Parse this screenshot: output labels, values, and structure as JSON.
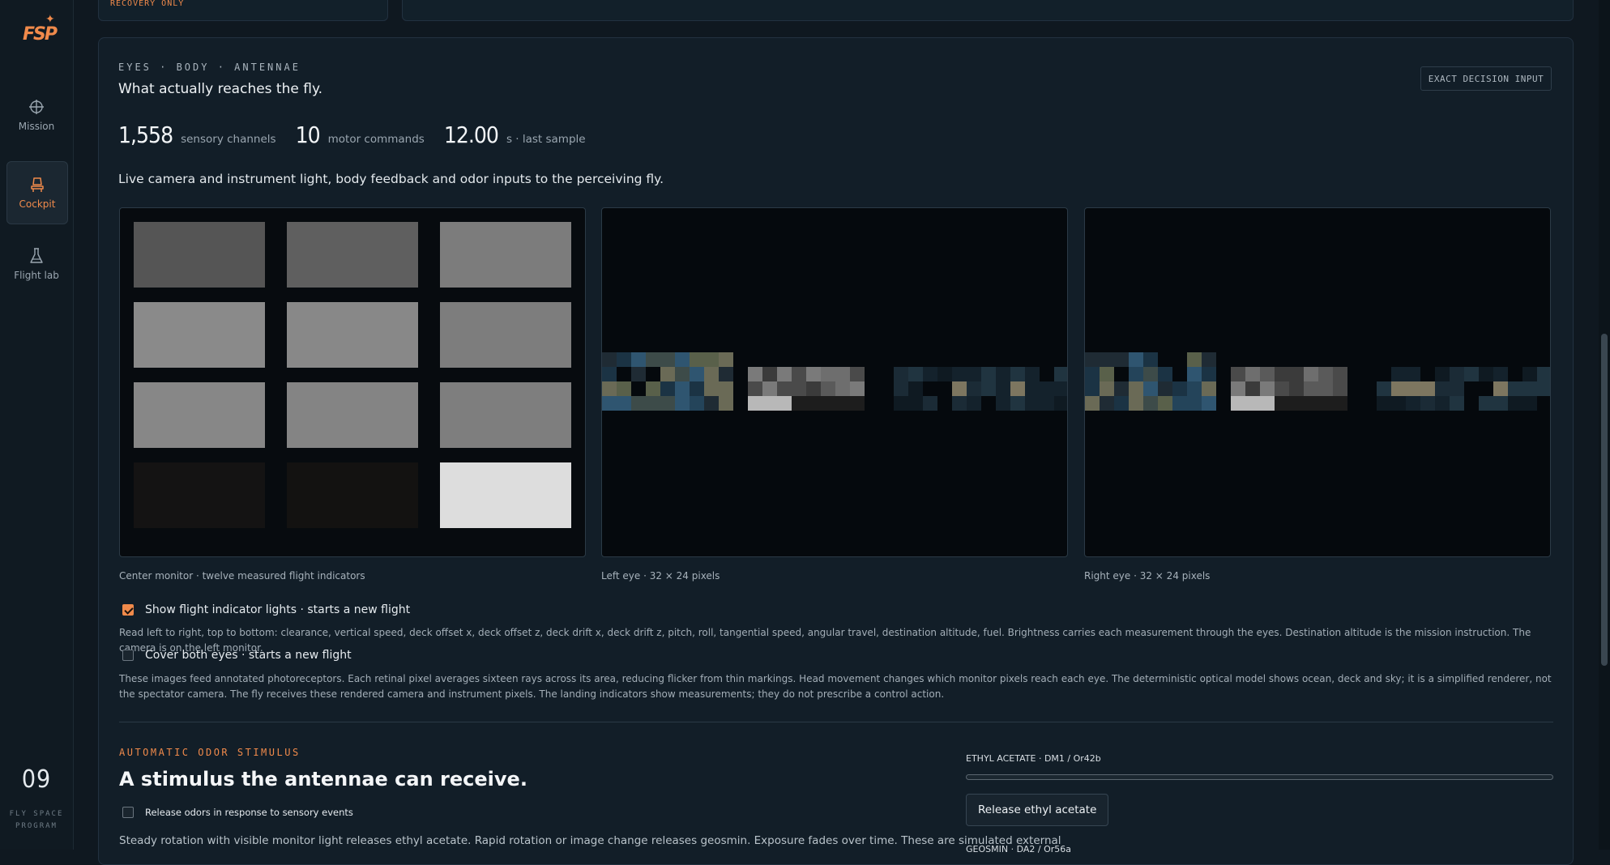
{
  "sidebar": {
    "logo_text": "FSP",
    "items": [
      {
        "label": "Mission",
        "icon": "crosshair-icon",
        "active": false
      },
      {
        "label": "Cockpit",
        "icon": "seat-icon",
        "active": true
      },
      {
        "label": "Flight lab",
        "icon": "flask-icon",
        "active": false
      }
    ],
    "number": "09",
    "caption_line1": "FLY SPACE",
    "caption_line2": "PROGRAM"
  },
  "top": {
    "left_stub": "RECOVERY ONLY"
  },
  "perception": {
    "eyebrow": "EYES · BODY · ANTENNAE",
    "headline": "What actually reaches the fly.",
    "badge": "EXACT DECISION INPUT",
    "stats": [
      {
        "value": "1,558",
        "label": "sensory channels"
      },
      {
        "value": "10",
        "label": "motor commands"
      },
      {
        "value": "12.00",
        "label": "s · last sample"
      }
    ],
    "intro": "Live camera and instrument light, body feedback and odor inputs to the perceiving fly.",
    "monitor_tiles": [
      "#555555",
      "#5f5f5f",
      "#7c7c7c",
      "#8a8a8a",
      "#888888",
      "#7d7d7d",
      "#878787",
      "#848484",
      "#7e7e7e",
      "#141313",
      "#131211",
      "#dddddd"
    ],
    "captions": {
      "monitor": "Center monitor · twelve measured flight indicators",
      "left_eye": "Left eye · 32 × 24 pixels",
      "right_eye": "Right eye · 32 × 24 pixels"
    },
    "option1": {
      "label": "Show flight indicator lights · starts a new flight",
      "checked": true
    },
    "option1_help": "Read left to right, top to bottom: clearance, vertical speed, deck offset x, deck offset z, deck drift x, deck drift z, pitch, roll, tangential speed, angular travel, destination altitude, fuel. Brightness carries each measurement through the eyes. Destination altitude is the mission instruction. The camera is on the left monitor.",
    "option2": {
      "label": "Cover both eyes · starts a new flight",
      "checked": false
    },
    "option2_help": "These images feed annotated photoreceptors. Each retinal pixel averages sixteen rays across its area, reducing flicker from thin markings. Head movement changes which monitor pixels reach each eye. The deterministic optical model shows ocean, deck and sky; it is a simplified renderer, not the spectator camera. The fly receives these rendered camera and instrument pixels. The landing indicators show measurements; they do not prescribe a control action."
  },
  "odor": {
    "eyebrow": "AUTOMATIC ODOR STIMULUS",
    "title": "A stimulus the antennae can receive.",
    "auto_release": {
      "label": "Release odors in response to sensory events",
      "checked": false
    },
    "description": "Steady rotation with visible monitor light releases ethyl acetate. Rapid rotation or image change releases geosmin. Exposure fades over time. These are simulated external",
    "channel1_label": "ETHYL ACETATE · DM1 / Or42b",
    "channel1_level": 0,
    "release_button": "Release ethyl acetate",
    "channel2_label": "GEOSMIN · DA2 / Or56a"
  },
  "colors": {
    "accent": "#f08a4b",
    "background": "#0f1820",
    "card": "#121e28"
  }
}
